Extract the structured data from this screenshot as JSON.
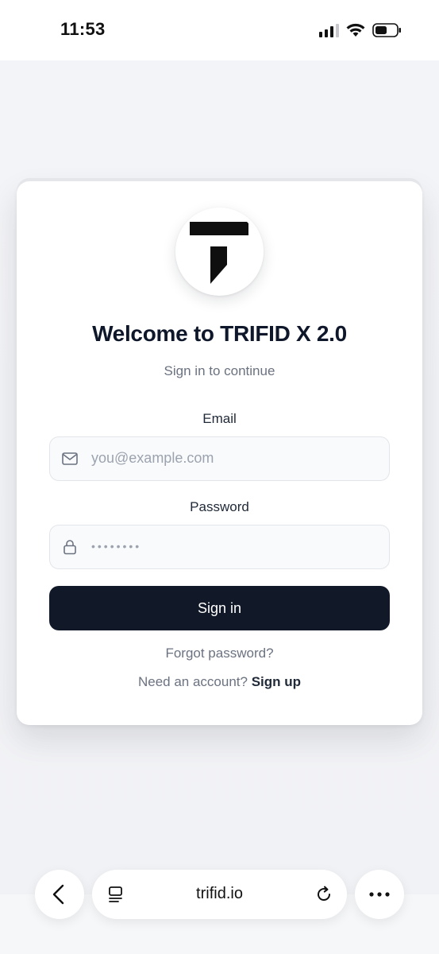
{
  "status_bar": {
    "time": "11:53"
  },
  "card": {
    "title": "Welcome to TRIFID X 2.0",
    "subtitle": "Sign in to continue",
    "email": {
      "label": "Email",
      "placeholder": "you@example.com",
      "icon": "mail-icon"
    },
    "password": {
      "label": "Password",
      "value_masked": "••••••••",
      "icon": "lock-icon"
    },
    "signin_label": "Sign in",
    "forgot_label": "Forgot password?",
    "signup_prompt": "Need an account?",
    "signup_link": "Sign up"
  },
  "browser": {
    "url": "trifid.io",
    "back_icon": "chevron-left-icon",
    "tabs_icon": "page-menu-icon",
    "reload_icon": "reload-icon",
    "more_icon": "more-icon"
  },
  "colors": {
    "primary_button": "#111827",
    "background": "#f1f3f6",
    "card": "#ffffff"
  }
}
